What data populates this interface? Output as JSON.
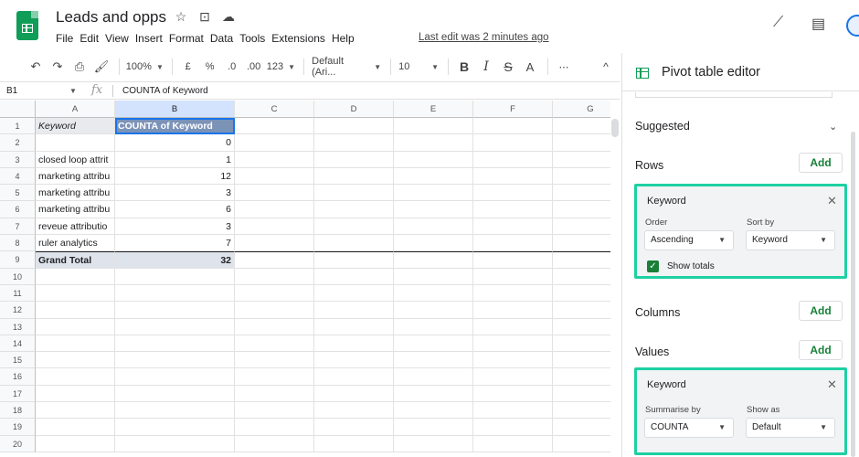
{
  "header": {
    "doc_title": "Leads and opps",
    "menus": [
      "File",
      "Edit",
      "View",
      "Insert",
      "Format",
      "Data",
      "Tools",
      "Extensions",
      "Help"
    ],
    "last_edit": "Last edit was 2 minutes ago",
    "icons": {
      "star": "star-icon",
      "move": "folder-move-icon",
      "cloud": "cloud-status-icon",
      "trend": "trend-icon",
      "comment": "comment-icon"
    }
  },
  "toolbar": {
    "zoom": "100%",
    "currency": "£",
    "percent": "%",
    "dec_less": ".0",
    "dec_more": ".00",
    "number_format": "123",
    "font": "Default (Ari...",
    "font_size": "10",
    "bold": "B",
    "italic": "I",
    "strike": "S",
    "text_color": "A",
    "more": "⋯",
    "collapse": "^"
  },
  "formula_bar": {
    "name_box": "B1",
    "fx": "fx",
    "content": "COUNTA of Keyword"
  },
  "grid": {
    "columns": [
      "A",
      "B",
      "C",
      "D",
      "E",
      "F",
      "G"
    ],
    "row_numbers": [
      "1",
      "2",
      "3",
      "4",
      "5",
      "6",
      "7",
      "8",
      "9",
      "10",
      "11",
      "12",
      "13",
      "14",
      "15",
      "16",
      "17",
      "18",
      "19",
      "20"
    ],
    "header_a": "Keyword",
    "header_b": "COUNTA of Keyword",
    "data_rows": [
      {
        "a": "",
        "b": "0"
      },
      {
        "a": "closed loop attrit",
        "b": "1"
      },
      {
        "a": "marketing attribu",
        "b": "12"
      },
      {
        "a": "marketing attribu",
        "b": "3"
      },
      {
        "a": "marketing attribu",
        "b": "6"
      },
      {
        "a": "reveue attributio",
        "b": "3"
      },
      {
        "a": "ruler analytics",
        "b": "7"
      }
    ],
    "total_label": "Grand Total",
    "total_value": "32"
  },
  "panel": {
    "title": "Pivot table editor",
    "suggested": "Suggested",
    "rows_label": "Rows",
    "columns_label": "Columns",
    "values_label": "Values",
    "add_label": "Add",
    "rows_card": {
      "title": "Keyword",
      "order_label": "Order",
      "order_value": "Ascending",
      "sort_label": "Sort by",
      "sort_value": "Keyword",
      "show_totals": "Show totals"
    },
    "values_card": {
      "title": "Keyword",
      "summarise_label": "Summarise by",
      "summarise_value": "COUNTA",
      "show_as_label": "Show as",
      "show_as_value": "Default"
    }
  }
}
